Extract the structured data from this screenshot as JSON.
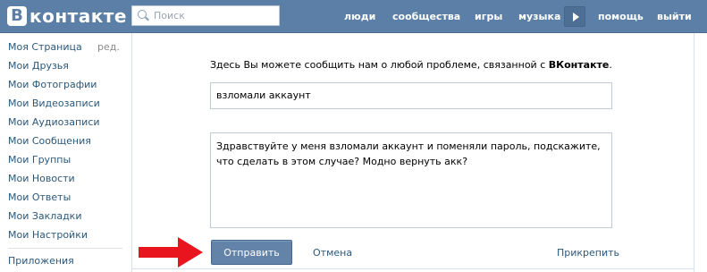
{
  "header": {
    "logo_letter": "B",
    "logo_text": "контакте",
    "search_placeholder": "Поиск",
    "nav": [
      "люди",
      "сообщества",
      "игры",
      "музыка",
      "помощь",
      "выйти"
    ]
  },
  "sidebar": {
    "items": [
      "Моя Страница",
      "Мои Друзья",
      "Мои Фотографии",
      "Мои Видеозаписи",
      "Мои Аудиозаписи",
      "Мои Сообщения",
      "Мои Группы",
      "Мои Новости",
      "Мои Ответы",
      "Мои Закладки",
      "Мои Настройки",
      "Приложения"
    ],
    "edit_label": "ред."
  },
  "form": {
    "intro_text": "Здесь Вы можете сообщить нам о любой проблеме, связанной с ",
    "intro_brand": "ВКонтакте",
    "intro_end": ".",
    "subject_value": "взломали аккаунт",
    "message_value": "Здравствуйте у меня взломали аккаунт и поменяли пароль, подскажите, что сделать в этом случае? Модно вернуть акк?",
    "send_label": "Отправить",
    "cancel_label": "Отмена",
    "attach_label": "Прикрепить"
  },
  "colors": {
    "header_bg": "#5b7fa6",
    "link": "#2b587a",
    "button_bg": "#6383a8",
    "arrow": "#e8141e"
  }
}
